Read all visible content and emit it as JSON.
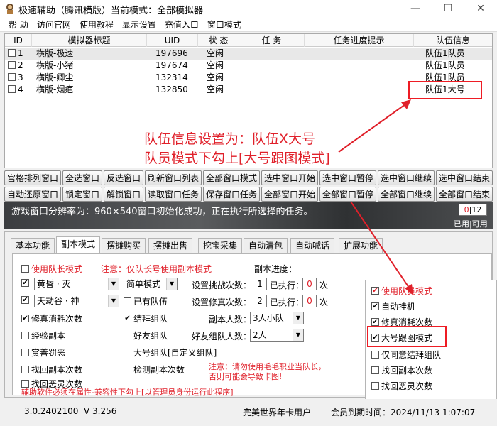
{
  "window": {
    "title": "极速辅助（腾讯横版）",
    "mode": "当前模式：全部模拟器"
  },
  "menu": [
    "帮 助",
    "访问官网",
    "使用教程",
    "显示设置",
    "充值入口",
    "窗口模式"
  ],
  "table": {
    "headers": [
      "ID",
      "模拟器标题",
      "UID",
      "状 态",
      "任 务",
      "任务进度提示",
      "队伍信息"
    ],
    "rows": [
      {
        "id": "1",
        "title": "横版-极速",
        "uid": "197696",
        "status": "空闲",
        "team": "队伍1队员"
      },
      {
        "id": "2",
        "title": "横版-小猪",
        "uid": "197674",
        "status": "空闲",
        "team": "队伍1队员"
      },
      {
        "id": "3",
        "title": "横版-卿尘",
        "uid": "132314",
        "status": "空闲",
        "team": "队伍1队员"
      },
      {
        "id": "4",
        "title": "横版-烟疤",
        "uid": "132850",
        "status": "空闲",
        "team": "队伍1大号"
      }
    ]
  },
  "annotation": {
    "line1": "队伍信息设置为：队伍X大号",
    "line2": "队员模式下勾上[大号跟图模式]",
    "color": "#e0202a"
  },
  "buttons_row1": [
    "宫格排列窗口",
    "全选窗口",
    "反选窗口",
    "刷新窗口列表",
    "全部窗口模式",
    "选中窗口开始",
    "选中窗口暂停",
    "选中窗口继续",
    "选中窗口结束"
  ],
  "buttons_row2": [
    "自动还原窗口",
    "锁定窗口",
    "解锁窗口",
    "读取窗口任务",
    "保存窗口任务",
    "全部窗口开始",
    "全部窗口暂停",
    "全部窗口继续",
    "全部窗口结束"
  ],
  "status": {
    "text": "游戏窗口分辨率为：960×540窗口初始化成功，正在执行所选择的任务。",
    "used": "0",
    "avail": "12",
    "labels": "已用|可用"
  },
  "tabs": [
    "基本功能",
    "副本模式",
    "摆摊购买",
    "摆摊出售",
    "挖宝采集",
    "自动清包",
    "自动喊话",
    "扩展功能"
  ],
  "panel": {
    "leader_mode": "使用队长模式",
    "leader_note": "注意：仅队长号使用副本模式",
    "progress_label": "副本进度：",
    "dungeon1": "黄昏 · 灭",
    "dungeon2": "天劫谷 · 神",
    "mode_select": "简单模式",
    "has_team": "已有队伍",
    "set_challenge": "设置挑战次数：",
    "set_repair": "设置修真次数：",
    "challenge_val": "1",
    "repair_val": "2",
    "executed1": "已执行：",
    "executed2": "已执行：",
    "exec_val1": "0",
    "exec_val2": "0",
    "times": "次",
    "repair_consume": "修真消耗次数",
    "sworn_team": "结拜组队",
    "dungeon_people": "副本人数：",
    "people_val": "3人小队",
    "exp_dungeon": "经验副本",
    "friend_team": "好友组队",
    "friend_people": "好友组队人数：",
    "friend_val": "2人",
    "reward_punish": "赏善罚恶",
    "main_custom": "大号组队[自定义组队]",
    "find_dungeon": "找回副本次数",
    "check_dungeon": "检测副本次数",
    "find_evil": "找回恶灵次数",
    "warn1": "注意：请勿使用毛毛职业当队长，",
    "warn2": "否则可能会导致卡图!",
    "admin_note": "辅助软件必须在属性-兼容性下勾上[以管理员身份运行此程序]",
    "right": [
      "使用队员模式",
      "自动挂机",
      "修真消耗次数",
      "大号跟图模式",
      "仅同意结拜组队",
      "找回副本次数",
      "找回恶灵次数"
    ]
  },
  "footer": {
    "version": "3.0.2402100",
    "v": "V 3.256",
    "user": "完美世界年卡用户",
    "expire": "会员到期时间：2024/11/13  1:07:07"
  }
}
